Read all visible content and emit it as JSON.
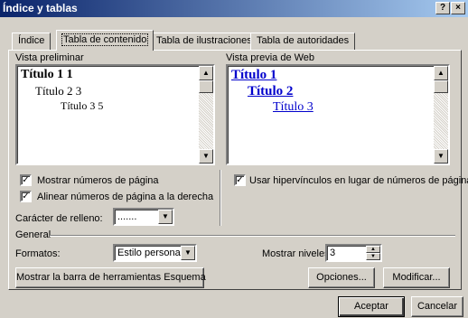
{
  "window": {
    "title": "Índice y tablas",
    "help_glyph": "?",
    "close_glyph": "×"
  },
  "tabs": [
    {
      "label": "Índice",
      "active": false
    },
    {
      "label": "Tabla de contenido",
      "active": true
    },
    {
      "label": "Tabla de ilustraciones",
      "active": false
    },
    {
      "label": "Tabla de autoridades",
      "active": false
    }
  ],
  "print_preview": {
    "label": "Vista preliminar",
    "entries": [
      {
        "text": "Título 1 1",
        "level": 1
      },
      {
        "text": "Título 2 3",
        "level": 2
      },
      {
        "text": "Título 3 5",
        "level": 3
      }
    ]
  },
  "web_preview": {
    "label": "Vista previa de Web",
    "entries": [
      {
        "text": "Título 1",
        "level": 1
      },
      {
        "text": "Título 2",
        "level": 2
      },
      {
        "text": "Título 3",
        "level": 3
      }
    ],
    "link_color": "#0000cc"
  },
  "options": {
    "show_page_numbers": {
      "label": "Mostrar números de página",
      "checked": true
    },
    "align_right": {
      "label": "Alinear números de página a la derecha",
      "checked": true
    },
    "use_hyperlinks": {
      "label": "Usar hipervínculos en lugar de números de página",
      "checked": true
    },
    "fill_char_label": "Carácter de relleno:",
    "fill_char_value": "......."
  },
  "general": {
    "label": "General",
    "formats_label": "Formatos:",
    "formats_value": "Estilo personal",
    "levels_label": "Mostrar niveles:",
    "levels_value": "3"
  },
  "buttons": {
    "outline_toolbar": "Mostrar la barra de herramientas Esquema",
    "options": "Opciones...",
    "modify": "Modificar...",
    "accept": "Aceptar",
    "cancel": "Cancelar"
  },
  "glyphs": {
    "check": "✓",
    "arrow_up": "▲",
    "arrow_down": "▼"
  }
}
